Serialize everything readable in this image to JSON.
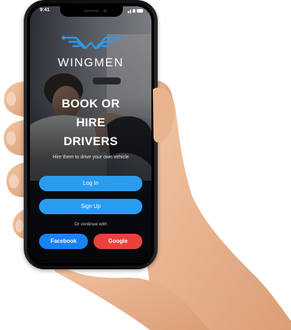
{
  "status_bar": {
    "time": "9:41"
  },
  "brand": {
    "logo_icon": "wings-logo-icon",
    "name": "WINGMEN",
    "accent_color": "#2a9cf0"
  },
  "hero": {
    "headline_line1": "BOOK OR",
    "headline_line2": "HIRE",
    "headline_line3": "DRIVERS",
    "tagline": "Hire them to drive your own vehicle"
  },
  "auth": {
    "login_label": "Log In",
    "signup_label": "Sign Up",
    "continue_text": "Or continue with",
    "facebook_label": "Facebook",
    "google_label": "Google",
    "facebook_color": "#1a82f2",
    "google_color": "#e9423e"
  }
}
